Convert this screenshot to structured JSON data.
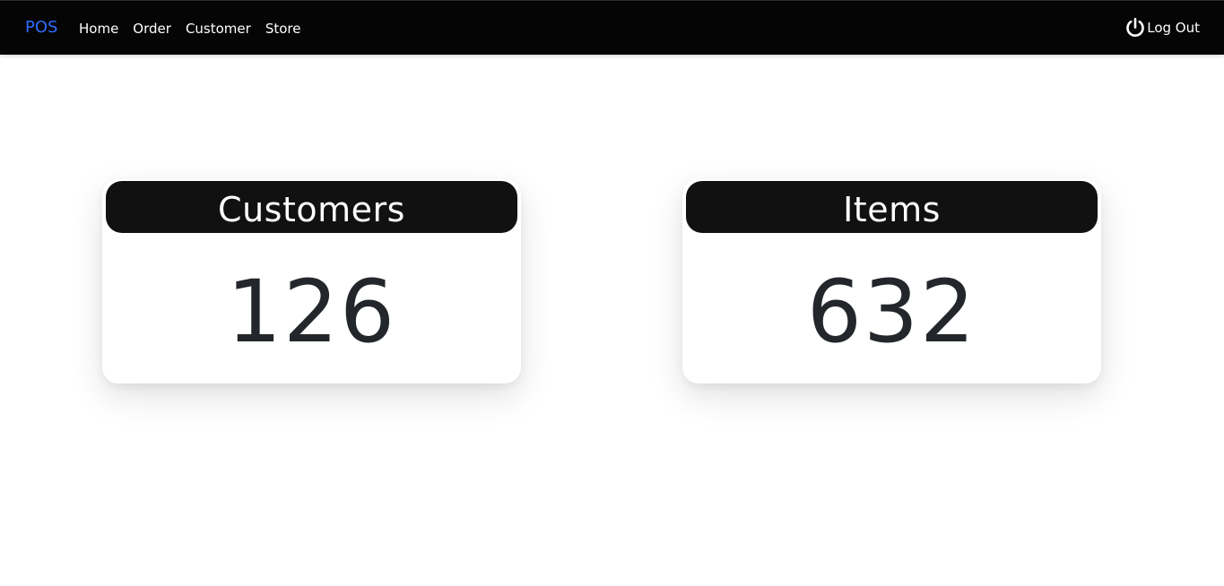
{
  "navbar": {
    "brand": "POS",
    "links": [
      "Home",
      "Order",
      "Customer",
      "Store"
    ],
    "logout_label": "Log Out",
    "logout_icon": "power-icon",
    "brand_color": "#2f6bff",
    "background": "#050505"
  },
  "cards": [
    {
      "title": "Customers",
      "value": "126"
    },
    {
      "title": "Items",
      "value": "632"
    }
  ]
}
